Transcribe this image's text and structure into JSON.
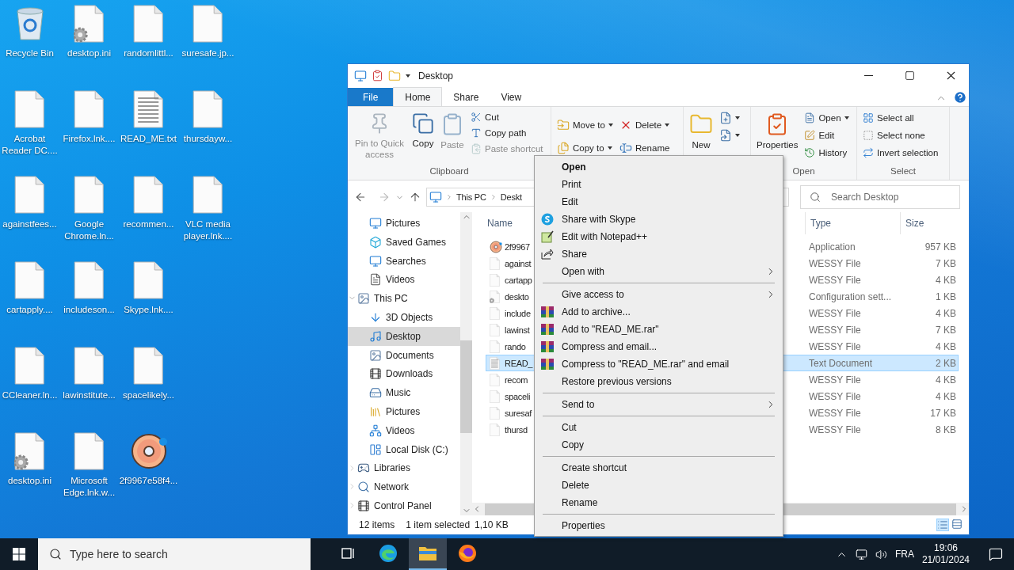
{
  "desktop_rows": [
    [
      {
        "label": "Recycle Bin",
        "kind": "recycle"
      },
      {
        "label": "desktop.ini",
        "kind": "gear"
      },
      {
        "label": "randomlittl...",
        "kind": "file"
      },
      {
        "label": "suresafe.jp...",
        "kind": "file"
      }
    ],
    [
      {
        "label": "Acrobat Reader DC....",
        "kind": "file"
      },
      {
        "label": "Firefox.lnk....",
        "kind": "file"
      },
      {
        "label": "READ_ME.txt",
        "kind": "text"
      },
      {
        "label": "thursdayw...",
        "kind": "file"
      }
    ],
    [
      {
        "label": "againstfees...",
        "kind": "file"
      },
      {
        "label": "Google Chrome.ln...",
        "kind": "file"
      },
      {
        "label": "recommen...",
        "kind": "file"
      },
      {
        "label": "VLC media player.lnk....",
        "kind": "file"
      }
    ],
    [
      {
        "label": "cartapply....",
        "kind": "file"
      },
      {
        "label": "includeson...",
        "kind": "file"
      },
      {
        "label": "Skype.lnk....",
        "kind": "file"
      }
    ],
    [
      {
        "label": "CCleaner.ln...",
        "kind": "file"
      },
      {
        "label": "lawinstitute...",
        "kind": "file"
      },
      {
        "label": "spacelikely...",
        "kind": "file"
      }
    ],
    [
      {
        "label": "desktop.ini",
        "kind": "gear"
      },
      {
        "label": "Microsoft Edge.lnk.w...",
        "kind": "file"
      },
      {
        "label": "2f9967e58f4...",
        "kind": "donut"
      }
    ]
  ],
  "explorer": {
    "title": "Desktop",
    "tabs": [
      {
        "label": "File",
        "kind": "file",
        "selected": false
      },
      {
        "label": "Home",
        "kind": "tab",
        "selected": true
      },
      {
        "label": "Share",
        "kind": "tab",
        "selected": false
      },
      {
        "label": "View",
        "kind": "tab",
        "selected": false
      }
    ],
    "ribbon_groups": [
      {
        "label": "Clipboard",
        "columns": [
          {
            "kind": "large",
            "item": {
              "label": "Pin to Quick access",
              "disabled": true
            }
          },
          {
            "kind": "large",
            "item": {
              "label": "Copy",
              "disabled": false
            }
          },
          {
            "kind": "large",
            "item": {
              "label": "Paste",
              "disabled": true
            }
          },
          {
            "kind": "small",
            "items": [
              {
                "label": "Cut",
                "disabled": false
              },
              {
                "label": "Copy path",
                "disabled": false
              },
              {
                "label": "Paste shortcut",
                "disabled": true
              }
            ]
          }
        ]
      },
      {
        "columns": [
          {
            "kind": "small",
            "items": [
              {
                "label": "Move to",
                "dropdown": true
              },
              {
                "label": "Copy to",
                "dropdown": true
              }
            ]
          },
          {
            "kind": "small",
            "items": [
              {
                "label": "Delete",
                "dropdown": true
              },
              {
                "label": "Rename",
                "dropdown": false
              }
            ]
          }
        ]
      },
      {
        "columns": [
          {
            "kind": "large",
            "item": {
              "label": "New"
            }
          },
          {
            "kind": "small",
            "items": [
              {
                "dropdown": true
              },
              {
                "dropdown": true
              }
            ]
          }
        ]
      },
      {
        "label": "Open",
        "columns": [
          {
            "kind": "large",
            "item": {
              "label": "Properties"
            }
          },
          {
            "kind": "small",
            "items": [
              {
                "label": "Open",
                "dropdown": true
              },
              {
                "label": "Edit",
                "dropdown": false
              },
              {
                "label": "History",
                "dropdown": false
              }
            ]
          }
        ]
      },
      {
        "label": "Select",
        "columns": [
          {
            "kind": "small",
            "items": [
              {
                "label": "Select all"
              },
              {
                "label": "Select none"
              },
              {
                "label": "Invert selection"
              }
            ]
          }
        ]
      }
    ],
    "breadcrumb": [
      "This PC",
      "Deskt"
    ],
    "search": {
      "placeholder": "Search Desktop"
    },
    "nav_tree": [
      {
        "children": [
          {
            "label": "Pictures",
            "selected": false
          },
          {
            "label": "Saved Games",
            "selected": false
          },
          {
            "label": "Searches",
            "selected": false
          },
          {
            "label": "Videos",
            "selected": false
          }
        ]
      },
      {
        "label": "This PC",
        "selected": false,
        "expanded": true,
        "children": [
          {
            "label": "3D Objects",
            "selected": false
          },
          {
            "label": "Desktop",
            "selected": true
          },
          {
            "label": "Documents",
            "selected": false
          },
          {
            "label": "Downloads",
            "selected": false
          },
          {
            "label": "Music",
            "selected": false
          },
          {
            "label": "Pictures",
            "selected": false
          },
          {
            "label": "Videos",
            "selected": false
          },
          {
            "label": "Local Disk (C:)",
            "selected": false
          }
        ]
      },
      {
        "label": "Libraries",
        "selected": false,
        "expanded": false
      },
      {
        "label": "Network",
        "selected": false,
        "expanded": false
      },
      {
        "label": "Control Panel",
        "selected": false,
        "expanded": false
      }
    ],
    "columns": [
      "Name",
      "Type",
      "Size"
    ],
    "files": [
      {
        "name": "2f9967",
        "type": "Application",
        "size": "957 KB",
        "kind": "donut",
        "selected": false
      },
      {
        "name": "against",
        "type": "WESSY File",
        "size": "7 KB",
        "kind": "file",
        "selected": false
      },
      {
        "name": "cartapp",
        "type": "WESSY File",
        "size": "4 KB",
        "kind": "file",
        "selected": false
      },
      {
        "name": "deskto",
        "type": "Configuration sett...",
        "size": "1 KB",
        "kind": "gear",
        "selected": false
      },
      {
        "name": "include",
        "type": "WESSY File",
        "size": "4 KB",
        "kind": "file",
        "selected": false
      },
      {
        "name": "lawinst",
        "type": "WESSY File",
        "size": "7 KB",
        "kind": "file",
        "selected": false
      },
      {
        "name": "rando",
        "type": "WESSY File",
        "size": "4 KB",
        "kind": "file",
        "selected": false
      },
      {
        "name": "READ_",
        "type": "Text Document",
        "size": "2 KB",
        "kind": "text",
        "selected": true
      },
      {
        "name": "recom",
        "type": "WESSY File",
        "size": "4 KB",
        "kind": "file",
        "selected": false
      },
      {
        "name": "spaceli",
        "type": "WESSY File",
        "size": "4 KB",
        "kind": "file",
        "selected": false
      },
      {
        "name": "suresaf",
        "type": "WESSY File",
        "size": "17 KB",
        "kind": "file",
        "selected": false
      },
      {
        "name": "thursd",
        "type": "WESSY File",
        "size": "8 KB",
        "kind": "file",
        "selected": false
      }
    ],
    "status": {
      "items": "12 items",
      "selection": "1 item selected",
      "size": "1,10 KB"
    }
  },
  "context_menu": [
    {
      "kind": "item",
      "label": "Open",
      "default": true,
      "submenu": false
    },
    {
      "kind": "item",
      "label": "Print",
      "default": false,
      "submenu": false
    },
    {
      "kind": "item",
      "label": "Edit",
      "default": false,
      "submenu": false
    },
    {
      "kind": "skype",
      "label": "Share with Skype",
      "default": false,
      "submenu": false
    },
    {
      "kind": "notepad",
      "label": "Edit with Notepad++",
      "default": false,
      "submenu": false
    },
    {
      "kind": "share",
      "label": "Share",
      "default": false,
      "submenu": false
    },
    {
      "kind": "item",
      "label": "Open with",
      "default": false,
      "submenu": true
    },
    {
      "kind": "separator"
    },
    {
      "kind": "item",
      "label": "Give access to",
      "default": false,
      "submenu": true
    },
    {
      "kind": "archive",
      "label": "Add to archive...",
      "default": false,
      "submenu": false
    },
    {
      "kind": "archive",
      "label": "Add to \"READ_ME.rar\"",
      "default": false,
      "submenu": false
    },
    {
      "kind": "archive",
      "label": "Compress and email...",
      "default": false,
      "submenu": false
    },
    {
      "kind": "archive",
      "label": "Compress to \"READ_ME.rar\" and email",
      "default": false,
      "submenu": false
    },
    {
      "kind": "item",
      "label": "Restore previous versions",
      "default": false,
      "submenu": false
    },
    {
      "kind": "separator"
    },
    {
      "kind": "item",
      "label": "Send to",
      "default": false,
      "submenu": true
    },
    {
      "kind": "separator"
    },
    {
      "kind": "item",
      "label": "Cut",
      "default": false,
      "submenu": false
    },
    {
      "kind": "item",
      "label": "Copy",
      "default": false,
      "submenu": false
    },
    {
      "kind": "separator"
    },
    {
      "kind": "item",
      "label": "Create shortcut",
      "default": false,
      "submenu": false
    },
    {
      "kind": "item",
      "label": "Delete",
      "default": false,
      "submenu": false
    },
    {
      "kind": "item",
      "label": "Rename",
      "default": false,
      "submenu": false
    },
    {
      "kind": "separator"
    },
    {
      "kind": "item",
      "label": "Properties",
      "default": false,
      "submenu": false
    }
  ],
  "taskbar": {
    "search": {
      "placeholder": "Type here to search"
    },
    "apps": [
      {
        "kind": "taskview",
        "selected": false
      },
      {
        "kind": "edge",
        "selected": false
      },
      {
        "kind": "explorer",
        "selected": true
      },
      {
        "kind": "firefox",
        "selected": false
      }
    ],
    "language": "FRA",
    "time": "19:06",
    "date": "21/01/2024"
  }
}
